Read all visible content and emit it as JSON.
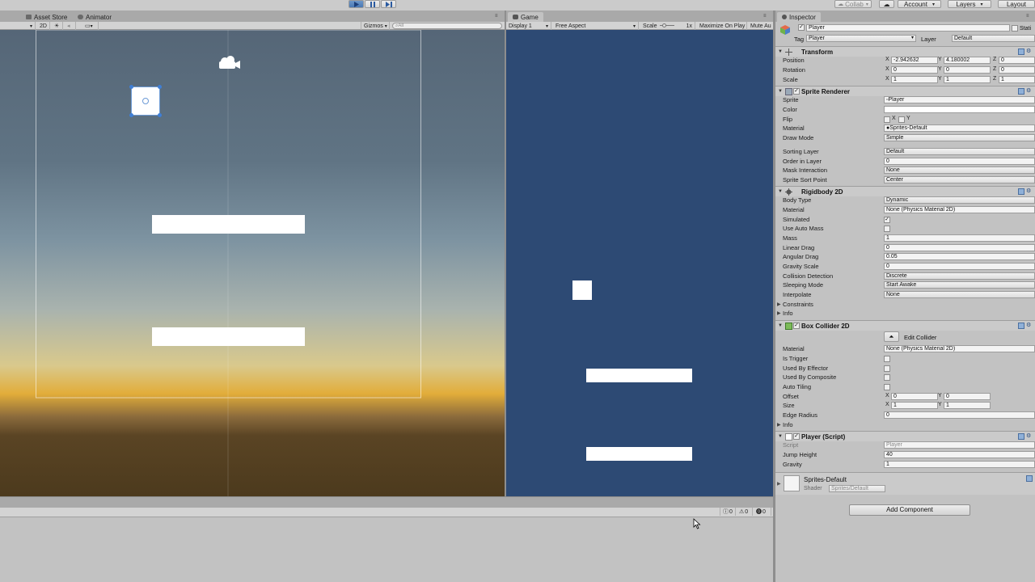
{
  "toolbar": {
    "collab_label": "Collab",
    "account_label": "Account",
    "layers_label": "Layers",
    "layout_label": "Layout",
    "play_icon": "play-icon",
    "pause_icon": "pause-icon",
    "step_icon": "step-icon"
  },
  "scene_panel": {
    "tabs": [
      {
        "label": "Asset Store",
        "icon": "asset-store-icon"
      },
      {
        "label": "Animator",
        "icon": "animator-icon"
      }
    ],
    "toolbar": {
      "mode_2d": "2D",
      "gizmos_label": "Gizmos",
      "search_placeholder": "All"
    }
  },
  "game_panel": {
    "tab_label": "Game",
    "display_label": "Display 1",
    "aspect_label": "Free Aspect",
    "scale_label": "Scale",
    "scale_value": "1x",
    "maximize_label": "Maximize On Play",
    "mute_label": "Mute Au",
    "background_color": "#2d4a74"
  },
  "console": {
    "info_count": "0",
    "warn_count": "0",
    "error_count": "0"
  },
  "inspector": {
    "tab_label": "Inspector",
    "object_name": "Player",
    "static_label": "Stati",
    "tag_label": "Tag",
    "tag_value": "Player",
    "layer_label": "Layer",
    "layer_value": "Default",
    "transform": {
      "title": "Transform",
      "position_label": "Position",
      "position": {
        "x": "-2.942632",
        "y": "4.180002",
        "z": "0"
      },
      "rotation_label": "Rotation",
      "rotation": {
        "x": "0",
        "y": "0",
        "z": "0"
      },
      "scale_label": "Scale",
      "scale": {
        "x": "1",
        "y": "1",
        "z": "1"
      }
    },
    "sprite_renderer": {
      "title": "Sprite Renderer",
      "sprite_label": "Sprite",
      "sprite_value": "Player",
      "color_label": "Color",
      "flip_label": "Flip",
      "flip_x": "X",
      "flip_y": "Y",
      "material_label": "Material",
      "material_value": "Sprites-Default",
      "draw_mode_label": "Draw Mode",
      "draw_mode_value": "Simple",
      "sorting_layer_label": "Sorting Layer",
      "sorting_layer_value": "Default",
      "order_label": "Order in Layer",
      "order_value": "0",
      "mask_label": "Mask Interaction",
      "mask_value": "None",
      "sort_point_label": "Sprite Sort Point",
      "sort_point_value": "Center"
    },
    "rigidbody": {
      "title": "Rigidbody 2D",
      "body_type_label": "Body Type",
      "body_type_value": "Dynamic",
      "material_label": "Material",
      "material_value": "None (Physics Material 2D)",
      "simulated_label": "Simulated",
      "simulated_checked": true,
      "auto_mass_label": "Use Auto Mass",
      "auto_mass_checked": false,
      "mass_label": "Mass",
      "mass_value": "1",
      "linear_drag_label": "Linear Drag",
      "linear_drag_value": "0",
      "angular_drag_label": "Angular Drag",
      "angular_drag_value": "0.05",
      "gravity_scale_label": "Gravity Scale",
      "gravity_scale_value": "0",
      "collision_label": "Collision Detection",
      "collision_value": "Discrete",
      "sleeping_label": "Sleeping Mode",
      "sleeping_value": "Start Awake",
      "interpolate_label": "Interpolate",
      "interpolate_value": "None",
      "constraints_label": "Constraints",
      "info_label": "Info"
    },
    "box_collider": {
      "title": "Box Collider 2D",
      "edit_collider_label": "Edit Collider",
      "material_label": "Material",
      "material_value": "None (Physics Material 2D)",
      "is_trigger_label": "Is Trigger",
      "used_by_effector_label": "Used By Effector",
      "used_by_composite_label": "Used By Composite",
      "auto_tiling_label": "Auto Tiling",
      "offset_label": "Offset",
      "offset": {
        "x": "0",
        "y": "0"
      },
      "size_label": "Size",
      "size": {
        "x": "1",
        "y": "1"
      },
      "edge_radius_label": "Edge Radius",
      "edge_radius_value": "0",
      "info_label": "Info"
    },
    "player_script": {
      "title": "Player (Script)",
      "script_label": "Script",
      "script_value": "Player",
      "jump_height_label": "Jump Height",
      "jump_height_value": "40",
      "gravity_label": "Gravity",
      "gravity_value": "1"
    },
    "material_preview": {
      "name": "Sprites-Default",
      "shader_label": "Shader",
      "shader_value": "Sprites/Default"
    },
    "add_component_label": "Add Component"
  }
}
